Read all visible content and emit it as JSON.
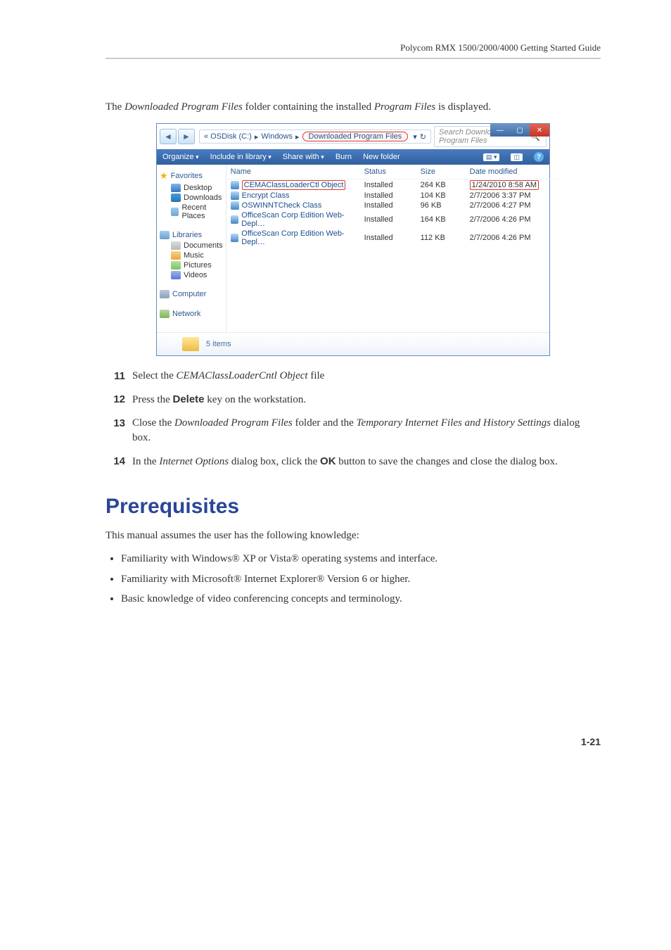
{
  "header": {
    "guide_title": "Polycom RMX 1500/2000/4000 Getting Started Guide"
  },
  "intro": {
    "pre": "The ",
    "em1": "Downloaded Program Files",
    "mid": " folder containing the installed ",
    "em2": "Program Files",
    "post": " is displayed."
  },
  "explorer": {
    "address": {
      "p1": "« OSDisk (C:)",
      "p2": "Windows",
      "p3": "Downloaded Program Files",
      "drop": "▾"
    },
    "search_placeholder": "Search Downloaded Program Files",
    "toolbar": {
      "organize": "Organize",
      "include": "Include in library",
      "share": "Share with",
      "burn": "Burn",
      "new_folder": "New folder"
    },
    "nav": {
      "favorites": "Favorites",
      "desktop": "Desktop",
      "downloads": "Downloads",
      "recent": "Recent Places",
      "libraries": "Libraries",
      "documents": "Documents",
      "music": "Music",
      "pictures": "Pictures",
      "videos": "Videos",
      "computer": "Computer",
      "network": "Network"
    },
    "columns": {
      "name": "Name",
      "status": "Status",
      "size": "Size",
      "date": "Date modified"
    },
    "files": [
      {
        "name": "CEMAClassLoaderCtl Object",
        "status": "Installed",
        "size": "264 KB",
        "date": "1/24/2010 8:58 AM",
        "hl": true
      },
      {
        "name": "Encrypt Class",
        "status": "Installed",
        "size": "104 KB",
        "date": "2/7/2006 3:37 PM"
      },
      {
        "name": "OSWINNTCheck Class",
        "status": "Installed",
        "size": "96 KB",
        "date": "2/7/2006 4:27 PM"
      },
      {
        "name": "OfficeScan Corp Edition Web-Depl…",
        "status": "Installed",
        "size": "164 KB",
        "date": "2/7/2006 4:26 PM"
      },
      {
        "name": "OfficeScan Corp Edition Web-Depl…",
        "status": "Installed",
        "size": "112 KB",
        "date": "2/7/2006 4:26 PM"
      }
    ],
    "status": "5 items"
  },
  "steps": {
    "s11": {
      "n": "11",
      "pre": "Select the ",
      "em": "CEMAClassLoaderCntl Object",
      "post": " file"
    },
    "s12": {
      "n": "12",
      "pre": "Press the ",
      "b": "Delete",
      "post": " key on the workstation."
    },
    "s13": {
      "n": "13",
      "pre": "Close the ",
      "em1": "Downloaded Program Files",
      "mid": " folder and the ",
      "em2": "Temporary Internet Files and History Settings",
      "post": " dialog box."
    },
    "s14": {
      "n": "14",
      "pre": "In the ",
      "em": "Internet Options",
      "mid": " dialog box, click the ",
      "b": "OK",
      "post": " button to save the changes and close the dialog box."
    }
  },
  "section_title": "Prerequisites",
  "prereq_intro": "This manual assumes the user has the following knowledge:",
  "bullets": {
    "b1": "Familiarity with Windows® XP or Vista® operating systems and interface.",
    "b2": "Familiarity with Microsoft® Internet Explorer® Version 6 or higher.",
    "b3": "Basic knowledge of video conferencing concepts and terminology."
  },
  "page_num": "1-21"
}
